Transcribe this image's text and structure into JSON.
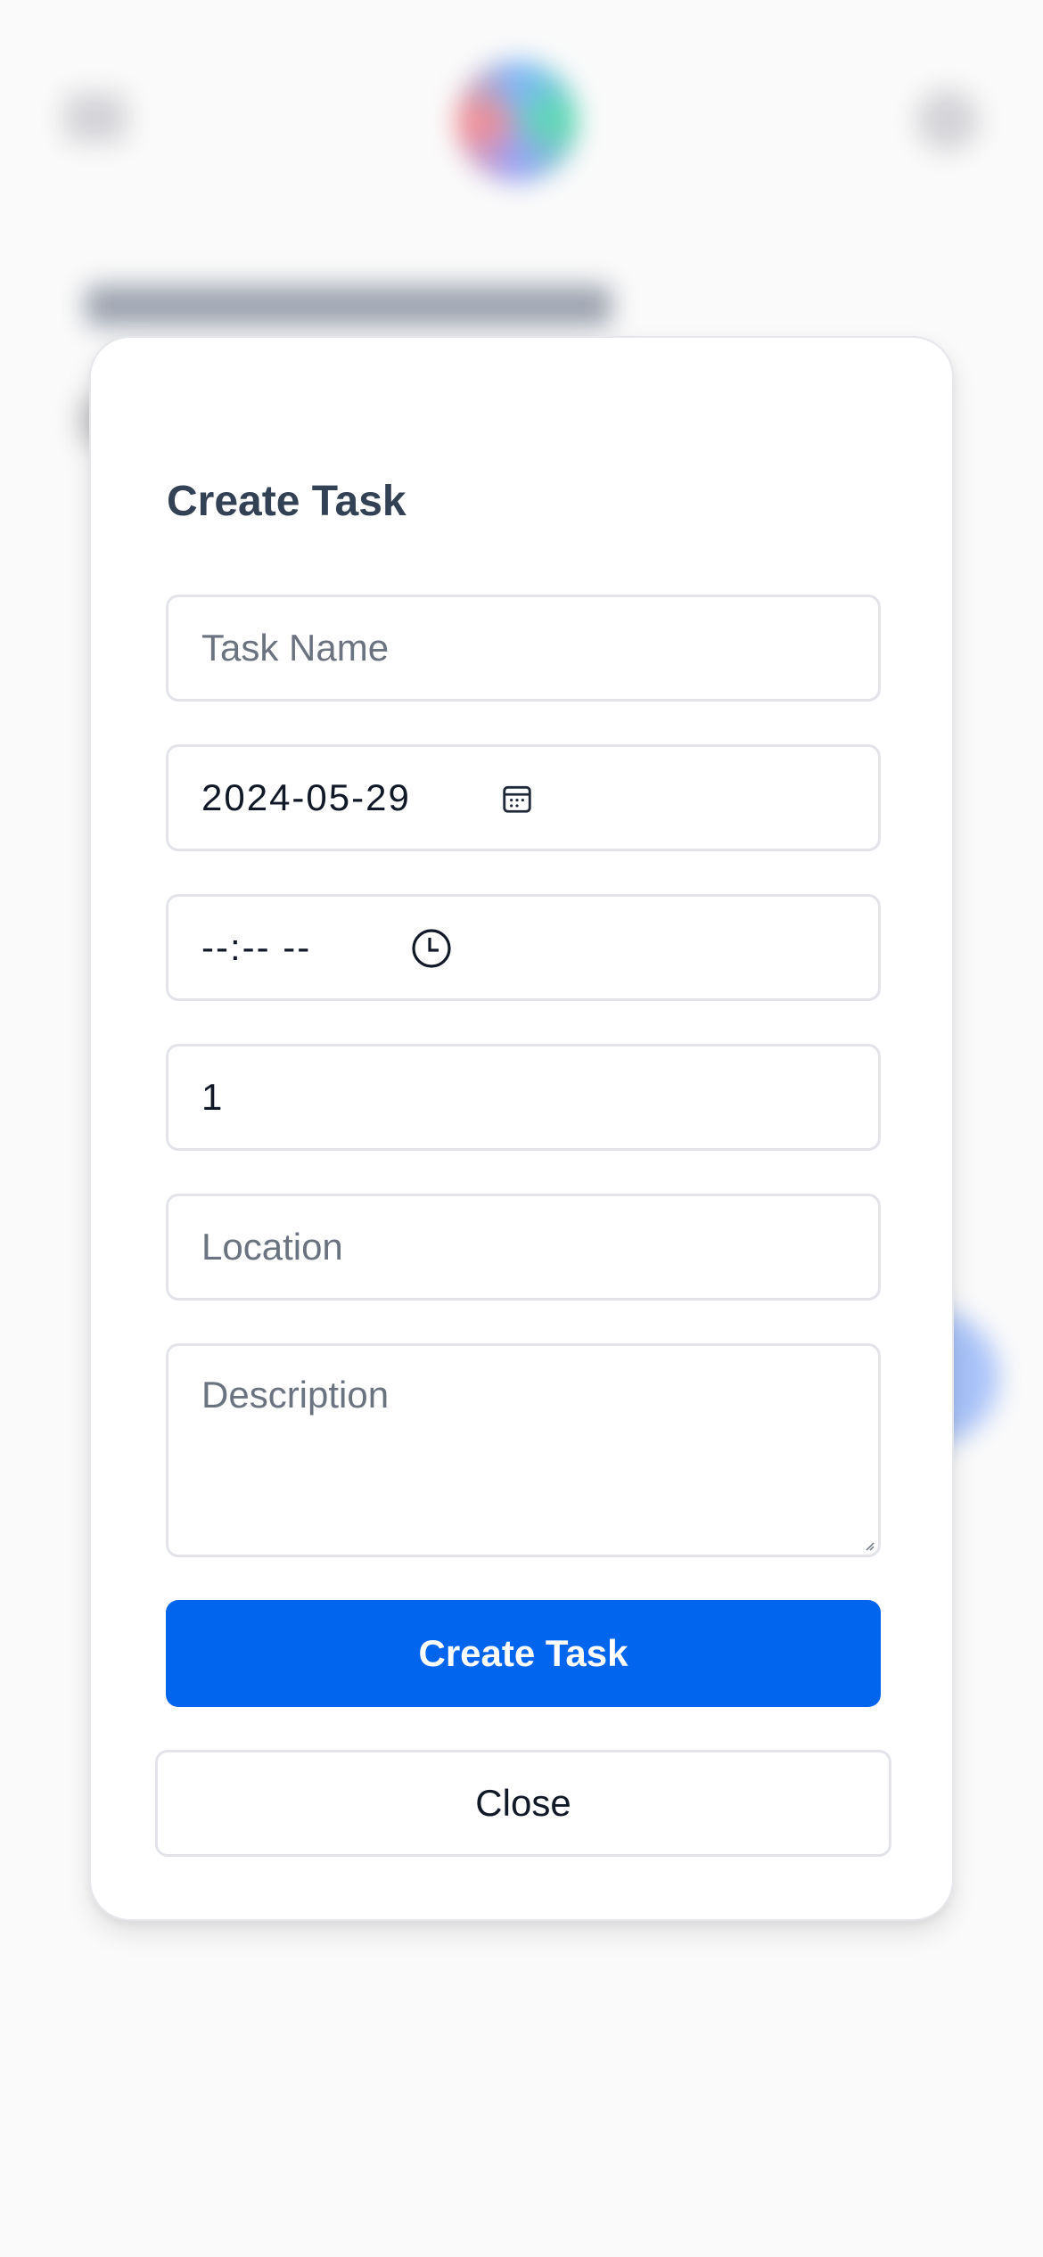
{
  "modal": {
    "title": "Create Task",
    "fields": {
      "task_name": {
        "value": "",
        "placeholder": "Task Name"
      },
      "date": {
        "value": "2024-05-29"
      },
      "time": {
        "value": "--:-- --"
      },
      "quantity": {
        "value": "1"
      },
      "location": {
        "value": "",
        "placeholder": "Location"
      },
      "description": {
        "value": "",
        "placeholder": "Description"
      }
    },
    "submit_label": "Create Task",
    "close_label": "Close"
  },
  "icons": {
    "date": "calendar-icon",
    "time": "clock-icon",
    "menu": "menu-icon",
    "avatar": "avatar"
  },
  "colors": {
    "primary": "#0265ee",
    "title_text": "#334155",
    "field_border": "#e2e4ea",
    "placeholder": "#6b7280",
    "page_background": "#fafafa"
  }
}
